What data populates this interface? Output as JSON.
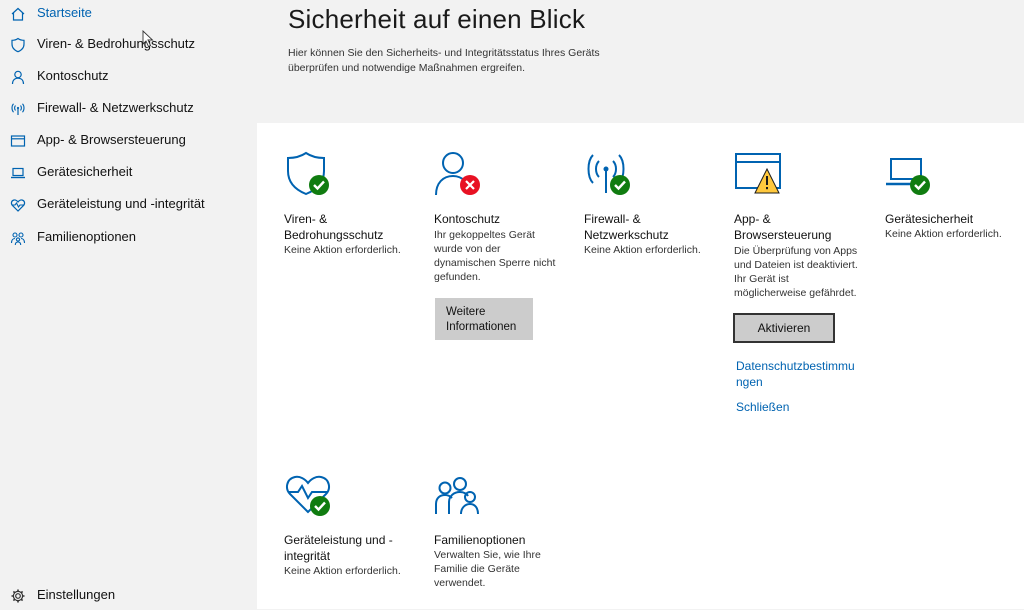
{
  "sidebar": {
    "items": [
      {
        "label": "Startseite",
        "icon": "home-icon",
        "active": true
      },
      {
        "label": "Viren- & Bedrohungsschutz",
        "icon": "shield-icon"
      },
      {
        "label": "Kontoschutz",
        "icon": "person-icon"
      },
      {
        "label": "Firewall- & Netzwerkschutz",
        "icon": "antenna-icon"
      },
      {
        "label": "App- & Browsersteuerung",
        "icon": "browser-window-icon"
      },
      {
        "label": "Gerätesicherheit",
        "icon": "laptop-icon"
      },
      {
        "label": "Geräteleistung und -integrität",
        "icon": "heart-pulse-icon"
      },
      {
        "label": "Familienoptionen",
        "icon": "family-icon"
      }
    ],
    "settings_label": "Einstellungen"
  },
  "header": {
    "title": "Sicherheit auf einen Blick",
    "description": "Hier können Sie den Sicherheits- und Integritätsstatus Ihres Geräts überprüfen und notwendige Maßnahmen ergreifen."
  },
  "colors": {
    "accent": "#0063b1",
    "ok": "#107c10",
    "error": "#e81123",
    "warning": "#ffc83d"
  },
  "tiles": {
    "virus": {
      "title": "Viren- & Bedrohungsschutz",
      "desc": "Keine Aktion erforderlich.",
      "status": "ok"
    },
    "account": {
      "title": "Kontoschutz",
      "desc": "Ihr gekoppeltes Gerät wurde von der dynamischen Sperre nicht gefunden.",
      "status": "error",
      "button": "Weitere Informationen"
    },
    "firewall": {
      "title": "Firewall- & Netzwerkschutz",
      "desc": "Keine Aktion erforderlich.",
      "status": "ok"
    },
    "app": {
      "title": "App- & Browsersteuerung",
      "desc": "Die Überprüfung von Apps und Dateien ist deaktiviert. Ihr Gerät ist möglicherweise gefährdet.",
      "status": "warning",
      "button": "Aktivieren",
      "link_privacy": "Datenschutzbestimmungen",
      "link_close": "Schließen"
    },
    "device": {
      "title": "Gerätesicherheit",
      "desc": "Keine Aktion erforderlich.",
      "status": "ok"
    },
    "performance": {
      "title": "Geräteleistung und -integrität",
      "desc": "Keine Aktion erforderlich.",
      "status": "ok"
    },
    "family": {
      "title": "Familienoptionen",
      "desc": "Verwalten Sie, wie Ihre Familie die Geräte verwendet."
    }
  }
}
